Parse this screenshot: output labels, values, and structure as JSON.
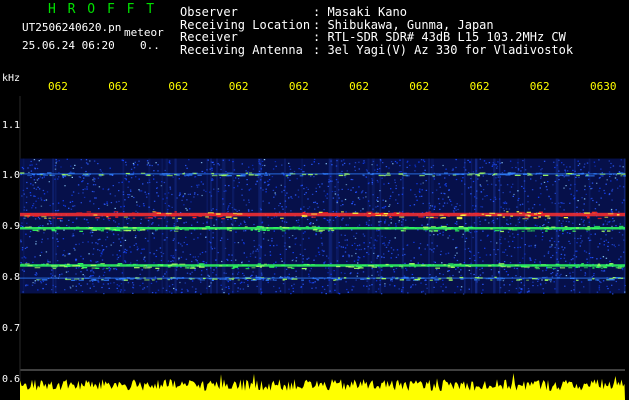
{
  "header": {
    "title": "H R O F F T",
    "file_name": "UT2506240620.pn",
    "meteor_label": "meteor",
    "datetime": "25.06.24 06:20",
    "abbrev": "0..",
    "info_rows": [
      {
        "key": "Observer",
        "value": ": Masaki Kano"
      },
      {
        "key": "Receiving Location",
        "value": ": Shibukawa, Gunma, Japan"
      },
      {
        "key": "Receiver",
        "value": ": RTL-SDR SDR# 43dB L15 103.2MHz CW"
      },
      {
        "key": "Receiving Antenna",
        "value": ": 3el Yagi(V) Az 330 for Vladivostok"
      }
    ]
  },
  "chart_data": {
    "type": "heatmap",
    "ylabel": "kHz",
    "y_ticks": [
      {
        "label": "1.1",
        "value": 1.1
      },
      {
        "label": "1.0",
        "value": 1.0
      },
      {
        "label": "0.9",
        "value": 0.9
      },
      {
        "label": "0.8",
        "value": 0.8
      },
      {
        "label": "0.7",
        "value": 0.7
      },
      {
        "label": "0.6",
        "value": 0.6
      }
    ],
    "ylim": [
      0.6,
      1.15
    ],
    "x_ticks": [
      "062",
      "062",
      "062",
      "062",
      "062",
      "062",
      "062",
      "062",
      "062",
      "0630"
    ],
    "signal_range_khz": [
      0.77,
      1.035
    ],
    "bands_khz": [
      {
        "center": 0.925,
        "intensity": "strong",
        "color": "#ff3030"
      },
      {
        "center": 0.898,
        "intensity": "medium",
        "color": "#30ff60"
      },
      {
        "center": 0.825,
        "intensity": "medium",
        "color": "#30ff60"
      },
      {
        "center": 1.005,
        "intensity": "weak",
        "color": "#3080ff"
      },
      {
        "center": 0.8,
        "intensity": "weak",
        "color": "#3080ff"
      }
    ],
    "noise_color": "#1040ff",
    "bottom_meter_color": "#ffff00",
    "grid": false
  }
}
